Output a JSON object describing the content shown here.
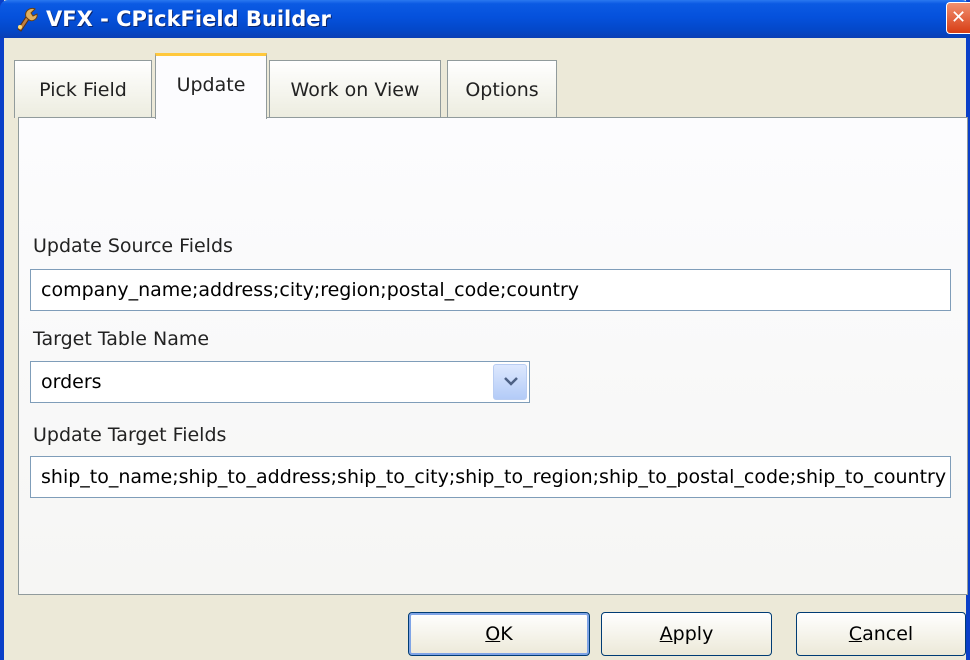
{
  "window": {
    "title": "VFX - CPickField Builder",
    "close_glyph": "✕",
    "accent": "#0a3fc8"
  },
  "tabs": [
    {
      "label": "Pick Field",
      "selected": false
    },
    {
      "label": "Update",
      "selected": true
    },
    {
      "label": "Work on View",
      "selected": false
    },
    {
      "label": "Options",
      "selected": false
    }
  ],
  "form": {
    "update_source_fields": {
      "label": "Update Source Fields",
      "value": "company_name;address;city;region;postal_code;country"
    },
    "target_table_name": {
      "label": "Target Table Name",
      "value": "orders"
    },
    "update_target_fields": {
      "label": "Update Target Fields",
      "value": "ship_to_name;ship_to_address;ship_to_city;ship_to_region;ship_to_postal_code;ship_to_country"
    }
  },
  "buttons": {
    "ok": {
      "mnemonic": "O",
      "rest": "K"
    },
    "apply": {
      "mnemonic": "A",
      "rest": "pply"
    },
    "cancel": {
      "mnemonic": "C",
      "rest": "ancel"
    }
  },
  "icons": {
    "app": "wrench-app-icon",
    "close": "close-icon",
    "dropdown": "chevron-down-icon"
  }
}
